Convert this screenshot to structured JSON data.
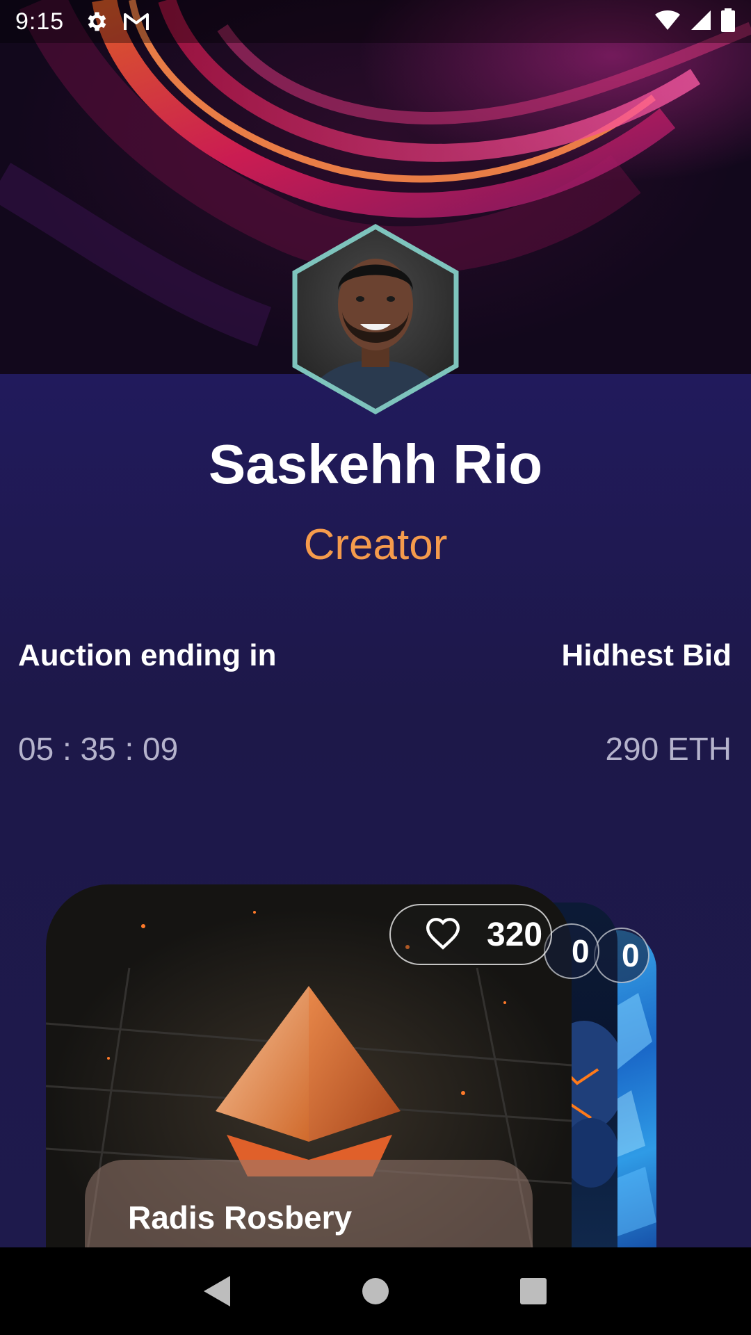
{
  "status_bar": {
    "time": "9:15",
    "icons": [
      "gear-icon",
      "gmail-icon"
    ],
    "right_icons": [
      "wifi-icon",
      "signal-icon",
      "battery-icon"
    ]
  },
  "profile": {
    "name": "Saskehh Rio",
    "role": "Creator"
  },
  "auction": {
    "ending_label": "Auction ending in",
    "highest_bid_label": "Hidhest Bid",
    "time_remaining": "05 : 35 : 09",
    "highest_bid_value": "290 ETH"
  },
  "cards": {
    "front": {
      "likes": "320",
      "title": "Radis Rosbery"
    },
    "back1_badge": "0",
    "back2_badge": "0"
  },
  "colors": {
    "accent": "#f59b4c",
    "background": "#1c1947",
    "avatar_border": "#7ec4bd"
  },
  "nav_bar": {
    "buttons": [
      "back-icon",
      "home-icon",
      "recents-icon"
    ]
  }
}
